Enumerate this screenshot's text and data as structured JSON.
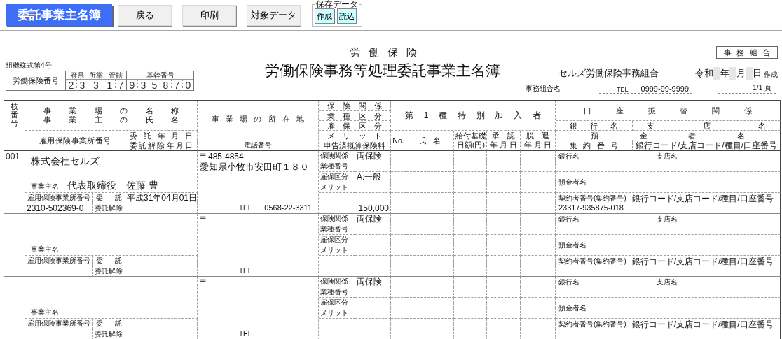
{
  "toolbar": {
    "title": "委託事業主名簿",
    "buttons": [
      "戻る",
      "印刷",
      "対象データ"
    ],
    "saved_data": {
      "legend": "保存データ",
      "buttons": [
        "作成",
        "読込"
      ]
    }
  },
  "form": {
    "form_number": "組機様式第4号",
    "subtitle": "労働保険",
    "title": "労働保険事務等処理委託事業主名簿",
    "badge": "事務組合",
    "union_name": "セルズ労働保険事務組合",
    "insurance_number": {
      "label": "労働保険番号",
      "groups": [
        {
          "label": "府県",
          "digits": [
            "2",
            "3"
          ]
        },
        {
          "label": "所掌",
          "digits": [
            "3"
          ]
        },
        {
          "label": "管轄",
          "digits": [
            "1",
            "7"
          ]
        },
        {
          "label": "基幹番号",
          "digits": [
            "9",
            "3",
            "5",
            "8",
            "7",
            "0"
          ]
        }
      ]
    },
    "date": {
      "era": "令和",
      "units": [
        "年",
        "月",
        "日"
      ],
      "suffix": "作成"
    },
    "union_label": "事務組合名",
    "tel_label": "TEL",
    "tel": "0999-99-9999",
    "page": "1/1 頁"
  },
  "table": {
    "header": {
      "branch": "枝番号",
      "name": [
        "事業場の名称",
        "事業主の氏名"
      ],
      "employment_no": "雇用保険事業所番号",
      "commission_date": "委託年月日",
      "cancel_date": "委託解除年月日",
      "location": "事業場の所在地",
      "phone": "電話番号",
      "insurance": [
        "保険関係",
        "業種区分",
        "雇保区分",
        "メリット",
        "申告済概算保険料"
      ],
      "special": "第1種特別加入者",
      "no": "No.",
      "person": "氏名",
      "benefit": [
        "給付基礎",
        "日額(円)"
      ],
      "approval": [
        "承　認",
        "年 月 日"
      ],
      "withdrawal": [
        "脱　退",
        "年 月 日"
      ],
      "bank": "口座振替関係",
      "bank_name": "銀行名",
      "branch_name": "支店名",
      "holder": "預金者名",
      "collection_no": "集約番号",
      "codes": "銀行コード/支店コード/種目/口座番号"
    },
    "records": [
      {
        "branch_no": "001",
        "business_name": "株式会社セルズ",
        "owner_label": "事業主名",
        "owner": "代表取締役　佐藤 豊",
        "employment_label": "雇用保険事業所番号",
        "employment_no": "2310-502369-0",
        "commission_label": "委託",
        "commission_date": "平成31年04月01日",
        "cancel_label": "委託解除",
        "postal": "〒485-4854",
        "address": "愛知県小牧市安田町１８０",
        "tel_label": "TEL",
        "tel": "0568-22-3311",
        "insurance": [
          {
            "label": "保険関係",
            "value": "両保険"
          },
          {
            "label": "業種番号"
          },
          {
            "label": "雇保区分",
            "value": "A:一般"
          },
          {
            "label": "メリット"
          }
        ],
        "premium": "150,000",
        "bank": {
          "bank_label": "銀行名",
          "branch_label": "支店名",
          "holder_label": "預金者名",
          "contract_label": "契約者番号(集約番号)",
          "code_label": "銀行コード/支店コード/種目/口座番号",
          "contract_no": "23317-935875-018"
        }
      },
      {
        "owner_label": "事業主名",
        "employment_label": "雇用保険事業所番号",
        "commission_label": "委託",
        "cancel_label": "委託解除",
        "postal": "〒",
        "tel_label": "TEL",
        "insurance": [
          {
            "label": "保険関係",
            "value": "両保険"
          },
          {
            "label": "業種番号"
          },
          {
            "label": "雇保区分"
          },
          {
            "label": "メリット"
          }
        ],
        "bank": {
          "bank_label": "銀行名",
          "branch_label": "支店名",
          "holder_label": "預金者名",
          "contract_label": "契約者番号(集約番号)",
          "code_label": "銀行コード/支店コード/種目/口座番号"
        }
      },
      {
        "owner_label": "事業主名",
        "employment_label": "雇用保険事業所番号",
        "commission_label": "委託",
        "cancel_label": "委託解除",
        "postal": "〒",
        "tel_label": "TEL",
        "insurance": [
          {
            "label": "保険関係",
            "value": "両保険"
          },
          {
            "label": "業種番号"
          },
          {
            "label": "雇保区分"
          },
          {
            "label": "メリット"
          }
        ],
        "bank": {
          "bank_label": "銀行名",
          "branch_label": "支店名",
          "holder_label": "預金者名",
          "contract_label": "契約者番号(集約番号)",
          "code_label": "銀行コード/支店コード/種目/口座番号"
        }
      }
    ]
  }
}
